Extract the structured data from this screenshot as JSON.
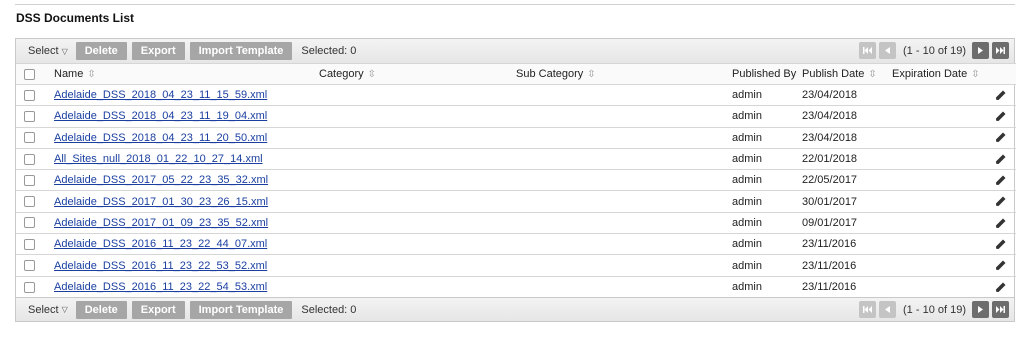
{
  "page": {
    "title": "DSS Documents List"
  },
  "toolbar": {
    "select_label": "Select",
    "delete_label": "Delete",
    "export_label": "Export",
    "import_label": "Import Template",
    "selected_text": "Selected: 0",
    "pager_text": "(1 - 10 of 19)"
  },
  "table": {
    "headers": {
      "name": "Name",
      "category": "Category",
      "sub_category": "Sub Category",
      "published_by": "Published By",
      "publish_date": "Publish Date",
      "expiration_date": "Expiration Date"
    },
    "rows": [
      {
        "name": "Adelaide_DSS_2018_04_23_11_15_59.xml",
        "category": "",
        "sub_category": "",
        "published_by": "admin",
        "publish_date": "23/04/2018",
        "expiration_date": ""
      },
      {
        "name": "Adelaide_DSS_2018_04_23_11_19_04.xml",
        "category": "",
        "sub_category": "",
        "published_by": "admin",
        "publish_date": "23/04/2018",
        "expiration_date": ""
      },
      {
        "name": "Adelaide_DSS_2018_04_23_11_20_50.xml",
        "category": "",
        "sub_category": "",
        "published_by": "admin",
        "publish_date": "23/04/2018",
        "expiration_date": ""
      },
      {
        "name": "All_Sites_null_2018_01_22_10_27_14.xml",
        "category": "",
        "sub_category": "",
        "published_by": "admin",
        "publish_date": "22/01/2018",
        "expiration_date": ""
      },
      {
        "name": "Adelaide_DSS_2017_05_22_23_35_32.xml",
        "category": "",
        "sub_category": "",
        "published_by": "admin",
        "publish_date": "22/05/2017",
        "expiration_date": ""
      },
      {
        "name": "Adelaide_DSS_2017_01_30_23_26_15.xml",
        "category": "",
        "sub_category": "",
        "published_by": "admin",
        "publish_date": "30/01/2017",
        "expiration_date": ""
      },
      {
        "name": "Adelaide_DSS_2017_01_09_23_35_52.xml",
        "category": "",
        "sub_category": "",
        "published_by": "admin",
        "publish_date": "09/01/2017",
        "expiration_date": ""
      },
      {
        "name": "Adelaide_DSS_2016_11_23_22_44_07.xml",
        "category": "",
        "sub_category": "",
        "published_by": "admin",
        "publish_date": "23/11/2016",
        "expiration_date": ""
      },
      {
        "name": "Adelaide_DSS_2016_11_23_22_53_52.xml",
        "category": "",
        "sub_category": "",
        "published_by": "admin",
        "publish_date": "23/11/2016",
        "expiration_date": ""
      },
      {
        "name": "Adelaide_DSS_2016_11_23_22_54_53.xml",
        "category": "",
        "sub_category": "",
        "published_by": "admin",
        "publish_date": "23/11/2016",
        "expiration_date": ""
      }
    ]
  },
  "icons": {
    "sort": "sort-icon",
    "edit": "pencil-icon",
    "first": "first-page-icon",
    "prev": "prev-page-icon",
    "next": "next-page-icon",
    "last": "last-page-icon"
  },
  "colors": {
    "button_bg": "#a6a6a6",
    "link": "#1a3fa0",
    "pager_enabled": "#6d6d6d",
    "pager_disabled": "#c4c4c4"
  }
}
